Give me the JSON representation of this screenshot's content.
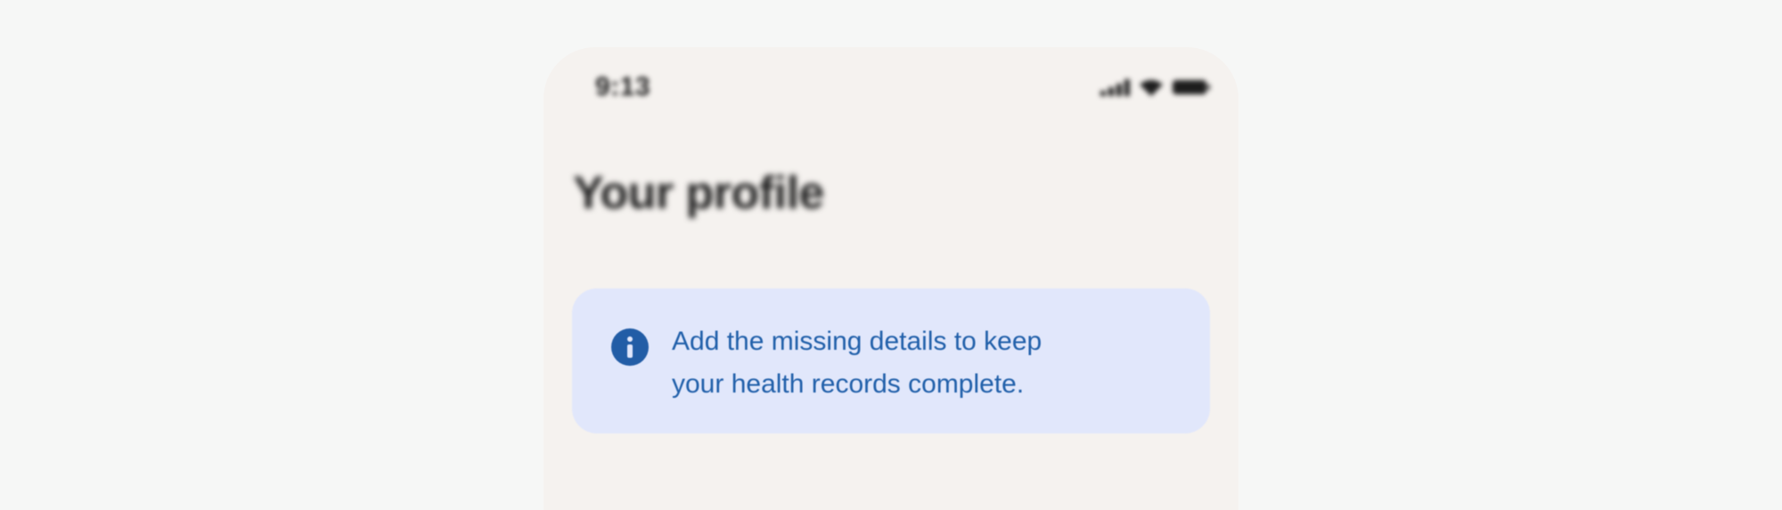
{
  "status_bar": {
    "time": "9:13",
    "icons": [
      "cellular-signal-icon",
      "wifi-icon",
      "battery-icon"
    ]
  },
  "page": {
    "title": "Your profile"
  },
  "info_banner": {
    "icon": "info-icon",
    "line1": "Add the missing details to keep",
    "line2": "your health records complete."
  },
  "colors": {
    "page_background": "#f6f7f6",
    "screen_background": "#f5f2ef",
    "banner_background": "#e1e7fb",
    "banner_accent": "#225da6",
    "banner_text": "#2160aa",
    "title_text": "#1e1e1e"
  }
}
